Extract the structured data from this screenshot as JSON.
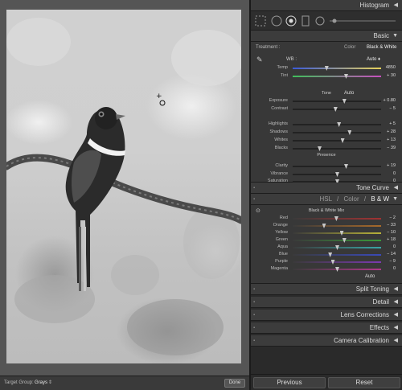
{
  "target_group": {
    "label": "Target Group:",
    "value": "Grays",
    "arrow": "⇕"
  },
  "done_label": "Done",
  "panels": {
    "histogram": "Histogram",
    "basic": "Basic",
    "tone_curve": "Tone Curve",
    "split_toning": "Split Toning",
    "detail": "Detail",
    "lens_corrections": "Lens Corrections",
    "effects": "Effects",
    "camera_calibration": "Camera Calibration"
  },
  "basic": {
    "treatment_label": "Treatment :",
    "treatment_color": "Color",
    "treatment_bw": "Black & White",
    "wb_label": "WB :",
    "wb_value": "Auto ♦",
    "tone_label": "Tone",
    "tone_auto": "Auto",
    "presence_label": "Presence",
    "sliders": [
      {
        "label": "Temp",
        "value": "4850",
        "pos": 0.38
      },
      {
        "label": "Tint",
        "value": "+ 30",
        "pos": 0.6
      },
      {
        "label": "Exposure",
        "value": "+ 0.80",
        "pos": 0.58
      },
      {
        "label": "Contrast",
        "value": "− 5",
        "pos": 0.48
      },
      {
        "label": "Highlights",
        "value": "+ 5",
        "pos": 0.52
      },
      {
        "label": "Shadows",
        "value": "+ 28",
        "pos": 0.64
      },
      {
        "label": "Whites",
        "value": "+ 13",
        "pos": 0.56
      },
      {
        "label": "Blacks",
        "value": "− 39",
        "pos": 0.3
      },
      {
        "label": "Clarity",
        "value": "+ 19",
        "pos": 0.6
      },
      {
        "label": "Vibrance",
        "value": "0",
        "pos": 0.5
      },
      {
        "label": "Saturation",
        "value": "0",
        "pos": 0.5
      }
    ]
  },
  "hsl": {
    "tab_hsl": "HSL",
    "sep": "/",
    "tab_color": "Color",
    "tab_bw": "B & W",
    "mix_label": "Black & White Mix",
    "auto": "Auto",
    "sliders": [
      {
        "label": "Red",
        "value": "− 2",
        "pos": 0.49
      },
      {
        "label": "Orange",
        "value": "− 33",
        "pos": 0.35
      },
      {
        "label": "Yellow",
        "value": "− 10",
        "pos": 0.55
      },
      {
        "label": "Green",
        "value": "+ 18",
        "pos": 0.58
      },
      {
        "label": "Aqua",
        "value": "0",
        "pos": 0.5
      },
      {
        "label": "Blue",
        "value": "− 14",
        "pos": 0.42
      },
      {
        "label": "Purple",
        "value": "− 9",
        "pos": 0.45
      },
      {
        "label": "Magenta",
        "value": "0",
        "pos": 0.5
      }
    ]
  },
  "buttons": {
    "previous": "Previous",
    "reset": "Reset"
  }
}
